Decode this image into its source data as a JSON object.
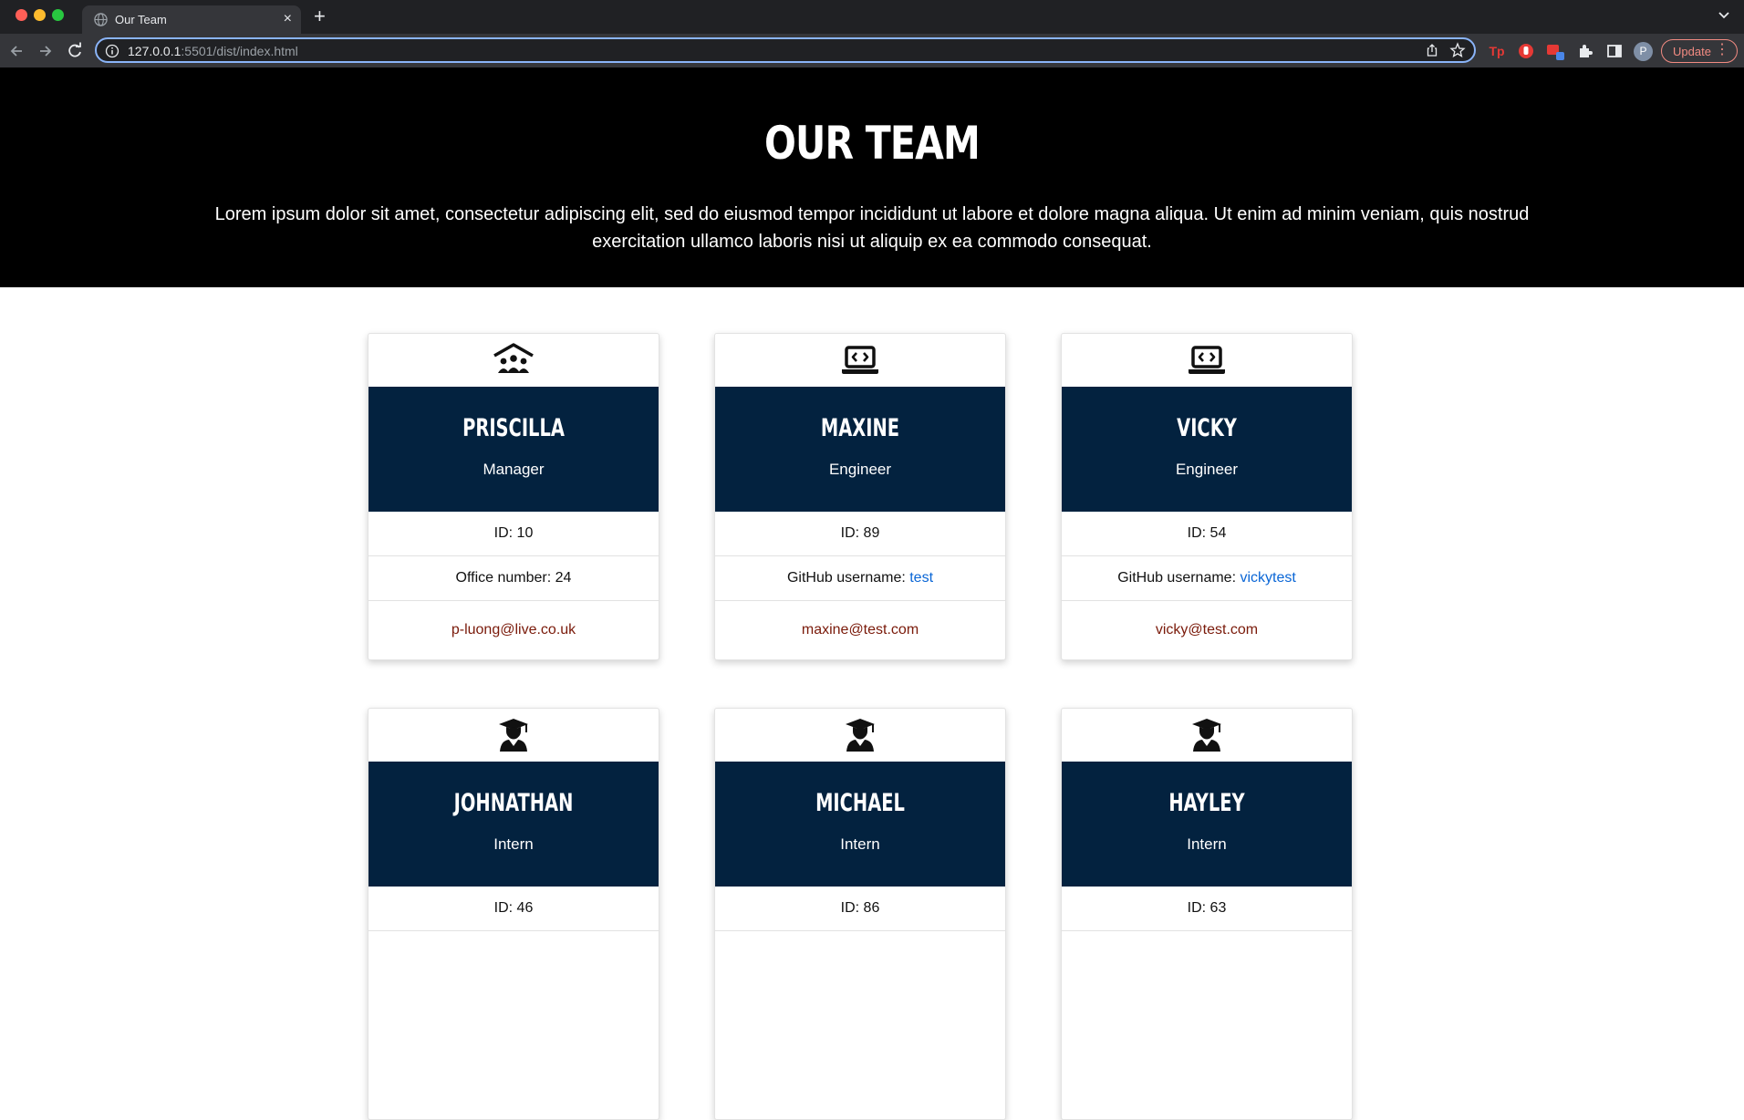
{
  "browser": {
    "tab_title": "Our Team",
    "tab_close": "×",
    "new_tab": "+",
    "url_host": "127.0.0.1",
    "url_rest": ":5501/dist/index.html",
    "avatar_letter": "P",
    "update_label": "Update",
    "update_menu": "⋮",
    "ext_tp_label": "Tp"
  },
  "hero": {
    "title": "OUR TEAM",
    "text": "Lorem ipsum dolor sit amet, consectetur adipiscing elit, sed do eiusmod tempor incididunt ut labore et dolore magna aliqua. Ut enim ad minim veniam, quis nostrud exercitation ullamco laboris nisi ut aliquip ex ea commodo consequat."
  },
  "colors": {
    "card_header": "#03223f",
    "email": "#7a1a0a",
    "github": "#0a66d6"
  },
  "cards": [
    {
      "icon": "manager-team-icon",
      "name": "PRISCILLA",
      "role": "Manager",
      "id_text": "ID: 10",
      "extra_label": "Office number: 24",
      "email": "p-luong@live.co.uk"
    },
    {
      "icon": "laptop-code-icon",
      "name": "MAXINE",
      "role": "Engineer",
      "id_text": "ID: 89",
      "extra_label": "GitHub username: ",
      "github": "test",
      "email": "maxine@test.com"
    },
    {
      "icon": "laptop-code-icon",
      "name": "VICKY",
      "role": "Engineer",
      "id_text": "ID: 54",
      "extra_label": "GitHub username: ",
      "github": "vickytest",
      "email": "vicky@test.com"
    },
    {
      "icon": "graduate-icon",
      "name": "JOHNATHAN",
      "role": "Intern",
      "id_text": "ID: 46"
    },
    {
      "icon": "graduate-icon",
      "name": "MICHAEL",
      "role": "Intern",
      "id_text": "ID: 86"
    },
    {
      "icon": "graduate-icon",
      "name": "HAYLEY",
      "role": "Intern",
      "id_text": "ID: 63"
    }
  ]
}
